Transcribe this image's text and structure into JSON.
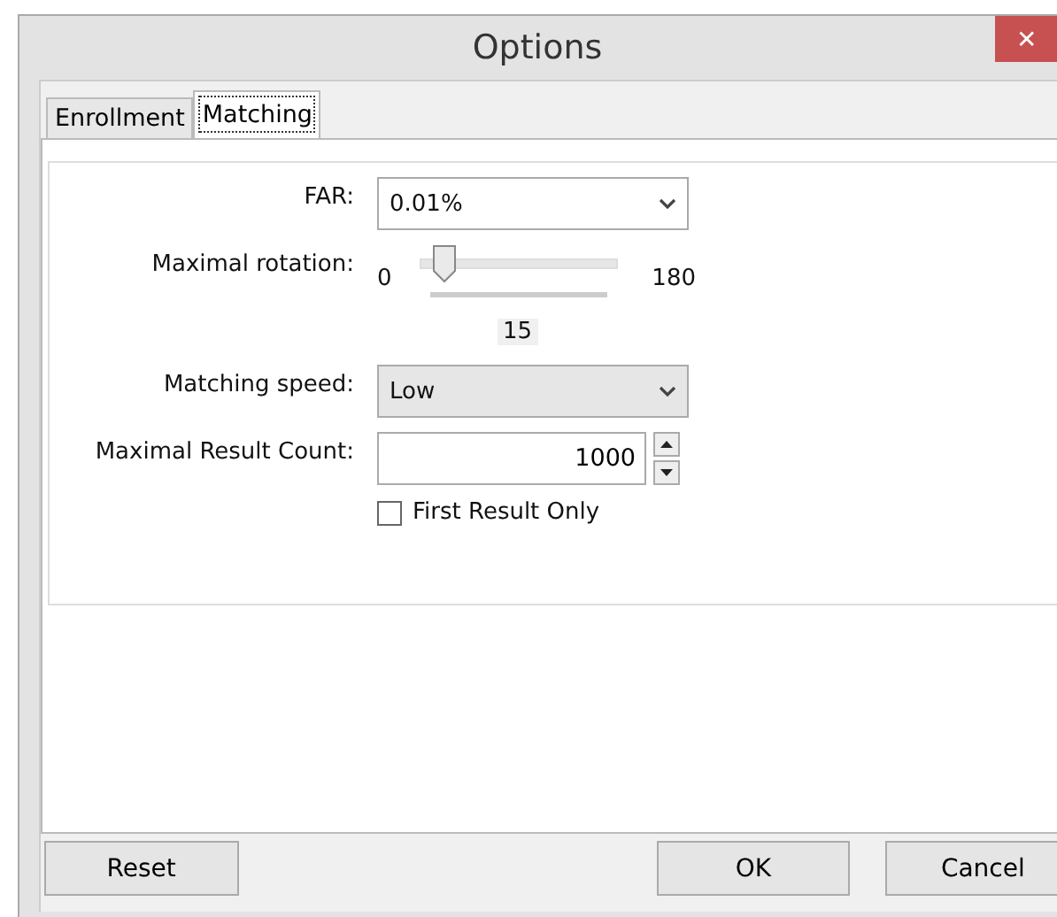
{
  "window": {
    "title": "Options",
    "close": "✕"
  },
  "tabs": [
    {
      "label": "Enrollment",
      "selected": false
    },
    {
      "label": "Matching",
      "selected": true
    }
  ],
  "far": {
    "label": "FAR:",
    "value": "0.01%"
  },
  "rotation": {
    "label": "Maximal rotation:",
    "min": "0",
    "max": "180",
    "reading": "15",
    "level": 0.083
  },
  "speed": {
    "label": "Matching speed:",
    "value": "Low"
  },
  "result_count": {
    "label": "Maximal Result Count:",
    "value": "1000"
  },
  "first_result_only": {
    "label": "First Result Only",
    "checked": false
  },
  "buttons": [
    {
      "label": "Reset",
      "kind": "left"
    },
    {
      "label": "OK",
      "kind": "right"
    },
    {
      "label": "Cancel",
      "kind": "right"
    }
  ]
}
